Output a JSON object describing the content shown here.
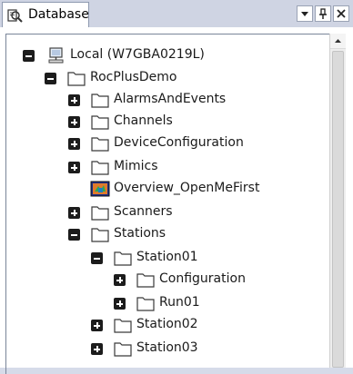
{
  "window": {
    "tab_title": "Database",
    "tab_icon": "database-search-icon",
    "header_buttons": [
      "dropdown-icon",
      "pin-icon",
      "close-icon"
    ]
  },
  "tree": {
    "root": {
      "label": "Local (W7GBA0219L)",
      "icon": "computer-icon",
      "expanded": true
    },
    "project": {
      "label": "RocPlusDemo",
      "icon": "folder-icon",
      "expanded": true
    },
    "children": [
      {
        "label": "AlarmsAndEvents",
        "icon": "folder-icon",
        "toggle": "plus"
      },
      {
        "label": "Channels",
        "icon": "folder-icon",
        "toggle": "plus"
      },
      {
        "label": "DeviceConfiguration",
        "icon": "folder-icon",
        "toggle": "plus"
      },
      {
        "label": "Mimics",
        "icon": "folder-icon",
        "toggle": "plus"
      },
      {
        "label": "Overview_OpenMeFirst",
        "icon": "mimic-icon",
        "toggle": "none"
      },
      {
        "label": "Scanners",
        "icon": "folder-icon",
        "toggle": "plus"
      },
      {
        "label": "Stations",
        "icon": "folder-icon",
        "toggle": "minus"
      }
    ],
    "stations": [
      {
        "label": "Station01",
        "icon": "folder-icon",
        "toggle": "minus"
      },
      {
        "label": "Station02",
        "icon": "folder-icon",
        "toggle": "plus"
      },
      {
        "label": "Station03",
        "icon": "folder-icon",
        "toggle": "plus"
      }
    ],
    "station01_children": [
      {
        "label": "Configuration",
        "icon": "folder-icon",
        "toggle": "plus"
      },
      {
        "label": "Run01",
        "icon": "folder-icon",
        "toggle": "plus"
      }
    ]
  },
  "colors": {
    "folder_stroke": "#3a3a3a",
    "toggle_fill": "#1c1c1c",
    "tab_strip": "#cfd4e3"
  }
}
